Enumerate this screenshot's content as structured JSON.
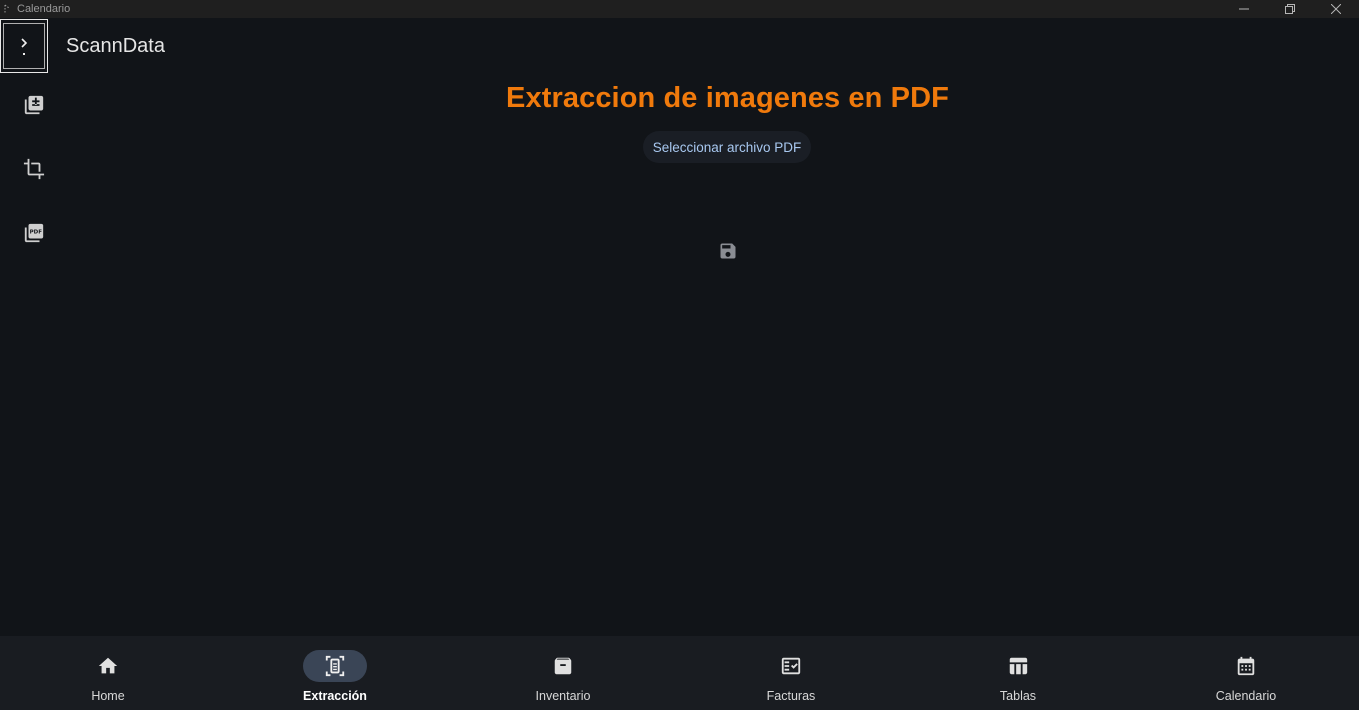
{
  "window": {
    "title": "Calendario"
  },
  "header": {
    "app_title": "ScannData",
    "menu_toggle": "chevron-right-icon"
  },
  "rail": {
    "items": [
      {
        "icon": "post-add-icon"
      },
      {
        "icon": "crop-icon"
      },
      {
        "icon": "picture-as-pdf-icon"
      }
    ]
  },
  "main": {
    "title": "Extraccion de imagenes en PDF",
    "select_button_label": "Seleccionar archivo PDF",
    "save_icon": "save-icon"
  },
  "bottom_nav": {
    "items": [
      {
        "label": "Home",
        "icon": "home-icon"
      },
      {
        "label": "Extracción",
        "icon": "document-scanner-icon",
        "active": true
      },
      {
        "label": "Inventario",
        "icon": "inventory-icon"
      },
      {
        "label": "Facturas",
        "icon": "fact-check-icon"
      },
      {
        "label": "Tablas",
        "icon": "table-icon"
      },
      {
        "label": "Calendario",
        "icon": "calendar-icon"
      }
    ]
  },
  "colors": {
    "background": "#111418",
    "accent_title": "#f07a0c",
    "button_text": "#a8c8f0",
    "nav_active_pill": "#3a4556",
    "nav_background": "#191c21"
  }
}
